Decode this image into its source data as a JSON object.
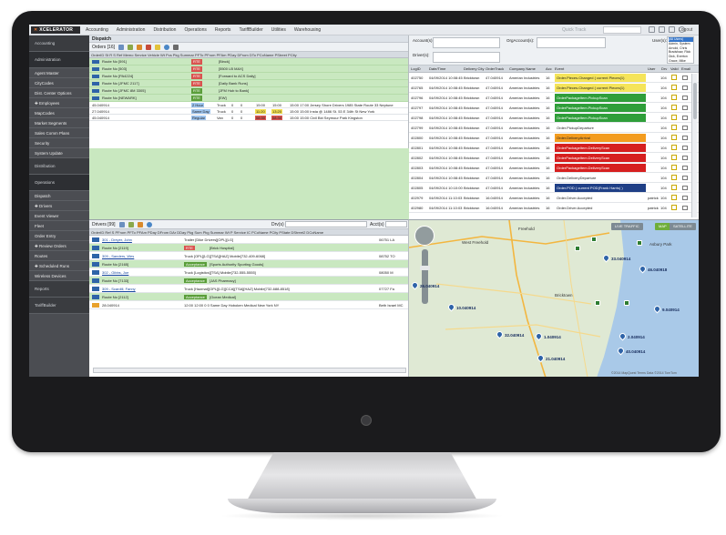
{
  "app": {
    "logo_text": "XCELERATOR",
    "menu": [
      "Accounting",
      "Administration",
      "Distribution",
      "Operations",
      "Reports",
      "TariffBuilder",
      "Utilities",
      "Warehousing"
    ],
    "quick_track_label": "Quick Track",
    "logout_label": "Logout"
  },
  "sidebar": {
    "items": [
      {
        "label": "Accounting",
        "kind": "sec"
      },
      {
        "label": "Administration",
        "kind": "sec act"
      },
      {
        "label": "Agent Master",
        "kind": ""
      },
      {
        "label": "CityCodes",
        "kind": ""
      },
      {
        "label": "Dist. Center Options",
        "kind": ""
      },
      {
        "label": "✚ Employees",
        "kind": ""
      },
      {
        "label": "MapCodes",
        "kind": ""
      },
      {
        "label": "Market Segments",
        "kind": ""
      },
      {
        "label": "Sales Comm Plans",
        "kind": ""
      },
      {
        "label": "Security",
        "kind": ""
      },
      {
        "label": "System Update",
        "kind": ""
      },
      {
        "label": "Distribution",
        "kind": "sec"
      },
      {
        "label": "Operations",
        "kind": "sec act"
      },
      {
        "label": "Dispatch",
        "kind": ""
      },
      {
        "label": "✚ Drivers",
        "kind": ""
      },
      {
        "label": "Event Viewer",
        "kind": ""
      },
      {
        "label": "Fleet",
        "kind": ""
      },
      {
        "label": "Order Entry",
        "kind": ""
      },
      {
        "label": "✚ Review Orders",
        "kind": ""
      },
      {
        "label": "Routes",
        "kind": ""
      },
      {
        "label": "✚ Scheduled Runs",
        "kind": ""
      },
      {
        "label": "Wireless Devices",
        "kind": ""
      },
      {
        "label": "Reports",
        "kind": "sec"
      },
      {
        "label": "TariffBuilder",
        "kind": "sec"
      }
    ]
  },
  "dispatch": {
    "title": "Dispatch",
    "orders_label": "Orders [16]",
    "columns": "OrderID   St  R  S  Ref  Memo  Service   Vehicle  Wt  Pcs  Pkg Summar  PFTo  PFrom  PFAm  PDay  DFrom  DTo  PCoName        PStreet        PCity",
    "routes": [
      {
        "label": "Route No [591]",
        "tag": "RTE",
        "tag_color": "#d9534f",
        "text": "[Binck]"
      },
      {
        "label": "Route No [503]",
        "tag": "RTE",
        "tag_color": "#d9534f",
        "text": "[5500 LB MAX]"
      },
      {
        "label": "Route No [PA4224]",
        "tag": "RTE",
        "tag_color": "#d9534f",
        "text": "[Forward to ACS Daily]"
      },
      {
        "label": "Route No [JFMC 2117]",
        "tag": "RTE",
        "tag_color": "#d9534f",
        "text": "[Daily Bank Runs]"
      },
      {
        "label": "Route No [JFMC 8M 3305]",
        "tag": "RTE",
        "tag_color": "#5a9e3a",
        "text": "[JFM Hub to Bank]"
      },
      {
        "label": "Route No [NEWARK]",
        "tag": "RTE",
        "tag_color": "#5a9e3a",
        "text": "[EW]"
      }
    ],
    "orders": [
      {
        "id": "45.040914",
        "service": "2 Hour",
        "svc_color": "#9ec5f0",
        "vehicle": "Truck",
        "wt": "0",
        "pcs": "0",
        "tfrom": "15:00",
        "tto": "15:00",
        "tcolor": "",
        "desc": "15:00 17:00 Jersey Shore Drivers 1985 State Route 33 Neptune"
      },
      {
        "id": "27.040914",
        "service": "Same Day",
        "svc_color": "#9ec5f0",
        "vehicle": "Truck",
        "wt": "0",
        "pcs": "0",
        "tfrom": "11:20",
        "tto": "13:20",
        "tcolor": "#f4e04d",
        "desc": "15:00 15:00 Insta @ 1486 St.   53 E 34th St     New York"
      },
      {
        "id": "45.040914",
        "service": "Regular",
        "svc_color": "#9ec5f0",
        "vehicle": "Van",
        "wt": "0",
        "pcs": "0",
        "tfrom": "08:30",
        "tto": "08:30",
        "tcolor": "#d9534f",
        "desc": "15:00 15:00 Civil Bkt              Seymour Park    Kingston"
      }
    ]
  },
  "drivers": {
    "label": "Drivers [99]",
    "search_label": "Drv(s)",
    "acct_label": "Acct(s)",
    "columns": "OrderID  Ref  S  PFrom  PFTo  PFAm  PDay  DFrom  DAr  DDay  Pkg Sum  Pkg Summar  Wt  P  Service   IC  PCoName       PCity    PState  DStreet2  DCoName",
    "rows": [
      {
        "kind": "drv",
        "label": "301 - Dreyer, John",
        "extra": "Trailer [Dike Drivers][OPL][LG]",
        "right": "06751 LA"
      },
      {
        "kind": "rte",
        "label": "Route No [2119]",
        "tag": "RTE",
        "tag_color": "#d9534f",
        "text": "[Brick Hospital]"
      },
      {
        "kind": "drv",
        "label": "309 - Sanders, Wes",
        "extra": "Truck [OPL][LG][TSA][HAZ]      Mobile[732-409-6068]",
        "right": "08752 TO"
      },
      {
        "kind": "rte",
        "label": "Route No [2165]",
        "tag": "Acceptance",
        "tag_color": "#5a9e3a",
        "text": "[Sports Authority Sporting Goods]"
      },
      {
        "kind": "drv",
        "label": "302 - Gibbs, Joe",
        "extra": "Truck [Logistics][TSA]          Mobile[732-555-5555]",
        "right": "08050 M"
      },
      {
        "kind": "rte",
        "label": "Route No [7133]",
        "tag": "Acceptance",
        "tag_color": "#5a9e3a",
        "text": "[JAS Pharmacy]"
      },
      {
        "kind": "drv",
        "label": "309 - Scardill, Fanny",
        "extra": "Truck [Hazmat][OPL][LG][CCA][TSA][HAZ]  Mobile[732-688-8518]",
        "right": "07727 Fa"
      },
      {
        "kind": "rte",
        "label": "Route No [2112]",
        "tag": "Acceptance",
        "tag_color": "#5a9e3a",
        "text": "[Ocean Medical]"
      },
      {
        "kind": "ord",
        "label": "28.040914",
        "extra": "12:00  12:00          0        0    Same Day   Hoboken Medical New York NY",
        "right": "Beth Israel MC"
      }
    ]
  },
  "log": {
    "filters": {
      "account": "Account(s):",
      "drivers": "Driver(s):",
      "orgacct": "OrgAccount(s):",
      "users": "User(s):"
    },
    "user_list": [
      "(All Users)",
      "Admin, System",
      "Arnold, Chris",
      "Bradshaw, Rick",
      "Dick, Everton",
      "Grace, Mike"
    ],
    "columns": {
      "logid": "LogID",
      "dt": "Date/Time",
      "dcity": "Delivery City",
      "ordtrack": "OrderTrack",
      "company": "Company Name",
      "acc": "Acc",
      "event": "Event",
      "user": "User",
      "drv": "Drv",
      "valid": "Valid",
      "email": "Email"
    },
    "rows": [
      {
        "logid": "402750",
        "dt": "04/09/2014 10:08:45",
        "city": "Bricktown",
        "track": "47.040914",
        "company": "Amerian Industries",
        "acc": "16",
        "event": "Order.Pieces.Changed ( current Pieces(1)",
        "ecolor": "#f5e45a",
        "efg": "#222",
        "drv": "104"
      },
      {
        "logid": "402765",
        "dt": "04/09/2014 10:08:45",
        "city": "Bricktown",
        "track": "47.040914",
        "company": "Amerian Industries",
        "acc": "16",
        "event": "Order.Pieces.Changed ( current Pieces(1)",
        "ecolor": "#f5e45a",
        "efg": "#222",
        "drv": "104"
      },
      {
        "logid": "402796",
        "dt": "04/09/2014 10:08:45",
        "city": "Bricktown",
        "track": "47.040914",
        "company": "Amerian Industries",
        "acc": "16",
        "event": "OrderPackageItem.PickupScan",
        "ecolor": "#2f9e3a",
        "efg": "#fff",
        "drv": "104"
      },
      {
        "logid": "402797",
        "dt": "04/09/2014 10:08:45",
        "city": "Bricktown",
        "track": "47.040914",
        "company": "Amerian Industries",
        "acc": "16",
        "event": "OrderPackageItem.PickupScan",
        "ecolor": "#2f9e3a",
        "efg": "#fff",
        "drv": "104"
      },
      {
        "logid": "402798",
        "dt": "04/09/2014 10:08:45",
        "city": "Bricktown",
        "track": "47.040914",
        "company": "Amerian Industries",
        "acc": "16",
        "event": "OrderPackageItem.PickupScan",
        "ecolor": "#2f9e3a",
        "efg": "#fff",
        "drv": "104"
      },
      {
        "logid": "402799",
        "dt": "04/09/2014 10:08:45",
        "city": "Bricktown",
        "track": "47.040914",
        "company": "Amerian Industries",
        "acc": "16",
        "event": "Order.PickupDeparture",
        "ecolor": "#ffffff",
        "efg": "#222",
        "drv": "104"
      },
      {
        "logid": "402800",
        "dt": "04/09/2014 10:08:45",
        "city": "Bricktown",
        "track": "47.040914",
        "company": "Amerian Industries",
        "acc": "16",
        "event": "Order.DeliveryArrival",
        "ecolor": "#f39c1f",
        "efg": "#222",
        "drv": "104"
      },
      {
        "logid": "402801",
        "dt": "04/09/2014 10:08:45",
        "city": "Bricktown",
        "track": "47.040914",
        "company": "Amerian Industries",
        "acc": "16",
        "event": "OrderPackageItem.DeliveryScan",
        "ecolor": "#d62020",
        "efg": "#fff",
        "drv": "104"
      },
      {
        "logid": "402802",
        "dt": "04/09/2014 10:08:45",
        "city": "Bricktown",
        "track": "47.040914",
        "company": "Amerian Industries",
        "acc": "16",
        "event": "OrderPackageItem.DeliveryScan",
        "ecolor": "#d62020",
        "efg": "#fff",
        "drv": "104"
      },
      {
        "logid": "402803",
        "dt": "04/09/2014 10:08:45",
        "city": "Bricktown",
        "track": "47.040914",
        "company": "Amerian Industries",
        "acc": "16",
        "event": "OrderPackageItem.DeliveryScan",
        "ecolor": "#d62020",
        "efg": "#fff",
        "drv": "104"
      },
      {
        "logid": "402804",
        "dt": "04/09/2014 10:08:45",
        "city": "Bricktown",
        "track": "47.040914",
        "company": "Amerian Industries",
        "acc": "16",
        "event": "Order.DeliveryDeparture",
        "ecolor": "#ffffff",
        "efg": "#222",
        "drv": "104"
      },
      {
        "logid": "402805",
        "dt": "04/09/2014 10:10:00",
        "city": "Bricktown",
        "track": "47.040914",
        "company": "Amerian Industries",
        "acc": "16",
        "event": "Order.POD ( current POD(Frank Harris) )",
        "ecolor": "#1f3f86",
        "efg": "#fff",
        "drv": "104"
      },
      {
        "logid": "402979",
        "dt": "04/09/2014 11:10:03",
        "city": "Bricktown",
        "track": "16.040914",
        "company": "Amerian Industries",
        "acc": "16",
        "event": "Order.Driver.Accepted",
        "ecolor": "#ffffff",
        "efg": "#222",
        "user": "patrick",
        "drv": "104"
      },
      {
        "logid": "402980",
        "dt": "04/09/2014 11:10:03",
        "city": "Bricktown",
        "track": "16.040914",
        "company": "Amerian Industries",
        "acc": "16",
        "event": "Order.Driver.Accepted",
        "ecolor": "#ffffff",
        "efg": "#222",
        "user": "patrick",
        "drv": "104"
      }
    ]
  },
  "map": {
    "buttons": [
      {
        "label": "LIVE TRAFFIC",
        "color": "#7d8a93"
      },
      {
        "label": "MAP",
        "color": "#6fae3a"
      },
      {
        "label": "SATELLITE",
        "color": "#7d8a93"
      }
    ],
    "places": [
      {
        "t": "Freehold"
      },
      {
        "t": "West Freehold"
      },
      {
        "t": "Asbury Park"
      },
      {
        "t": "Bricktown"
      }
    ],
    "labels": [
      "33.040914",
      "46.040918",
      "26.040914",
      "10.040914",
      "9.040914",
      "32.040914",
      "1.040914",
      "2.040914",
      "40.040914",
      "21.040914"
    ],
    "attribution": "©2014 MapQuest  Terms   Data ©2014 TomTom"
  }
}
